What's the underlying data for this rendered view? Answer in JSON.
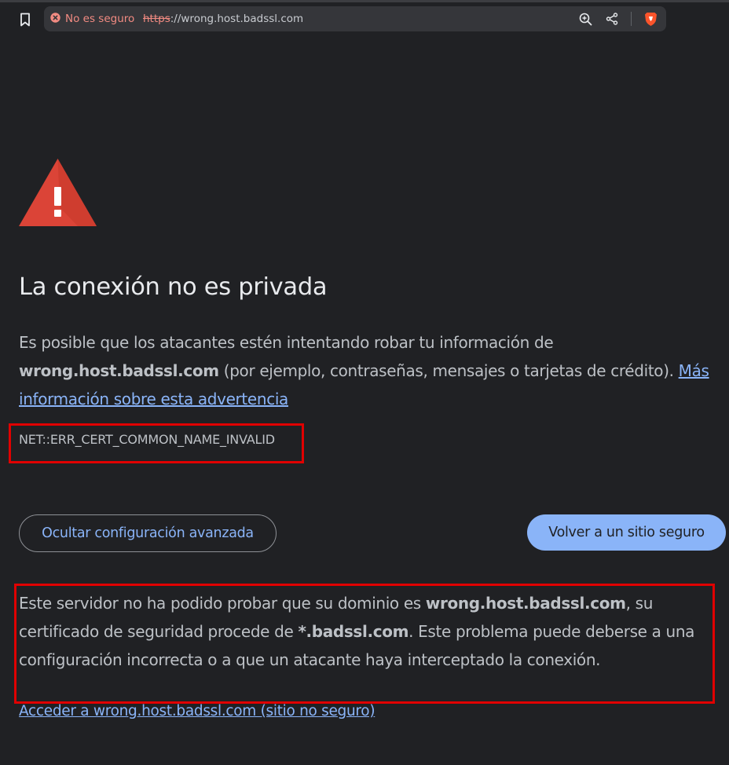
{
  "browser": {
    "security_chip": "No es seguro",
    "url_scheme": "https",
    "url_rest": "://wrong.host.badssl.com",
    "icons": [
      "bookmark-icon",
      "not-secure-icon",
      "zoom-icon",
      "share-icon",
      "brave-shields-icon"
    ]
  },
  "interstitial": {
    "heading": "La conexión no es privada",
    "explanation_prefix": "Es posible que los atacantes estén intentando robar tu información de ",
    "explanation_host": "wrong.host.badssl.com",
    "explanation_suffix": " (por ejemplo, contraseñas, mensajes o tarjetas de crédito). ",
    "learn_more_link": "Más información sobre esta advertencia",
    "error_code": "NET::ERR_CERT_COMMON_NAME_INVALID",
    "advanced_button": "Ocultar configuración avanzada",
    "back_button": "Volver a un sitio seguro",
    "details_1": "Este servidor no ha podido probar que su dominio es ",
    "details_host": "wrong.host.badssl.com",
    "details_2": ", su certificado de seguridad procede de ",
    "details_cert": "*.badssl.com",
    "details_3": ". Este problema puede deberse a una configuración incorrecta o a que un atacante haya interceptado la conexión.",
    "proceed_link": "Acceder a wrong.host.badssl.com (sitio no seguro)"
  },
  "colors": {
    "background": "#202124",
    "accent": "#8ab4f8",
    "danger": "#db4437",
    "annotation_box": "#e00000"
  }
}
